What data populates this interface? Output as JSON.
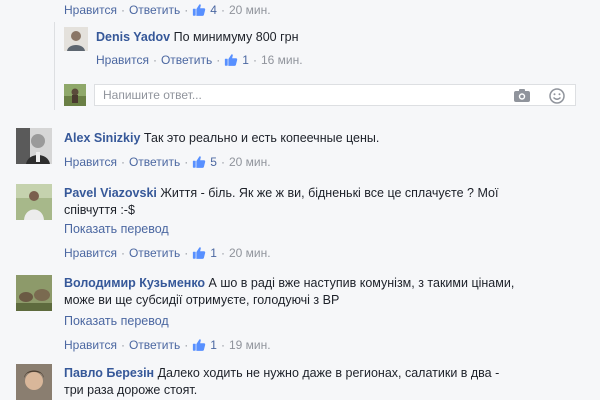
{
  "top_actions": {
    "like": "Нравится",
    "reply": "Ответить",
    "likes": "4",
    "time": "20 мин."
  },
  "reply": {
    "author": "Denis Yadov",
    "text": "По минимуму 800 грн",
    "like": "Нравится",
    "answer": "Ответить",
    "likes": "1",
    "time": "16 мин."
  },
  "reply_box": {
    "placeholder": "Напишите ответ..."
  },
  "comments": [
    {
      "author": "Alex Sinizkiy",
      "text": "Так это реально и есть копеечные цены.",
      "like": "Нравится",
      "answer": "Ответить",
      "likes": "5",
      "time": "20 мин."
    },
    {
      "author": "Pavel Viazovski",
      "text": "Життя - біль. Як же ж ви, бідненькі все це сплачуєте ? Мої",
      "text2": "співчуття :-$",
      "translate": "Показать перевод",
      "like": "Нравится",
      "answer": "Ответить",
      "likes": "1",
      "time": "20 мин."
    },
    {
      "author": "Володимир Кузьменко",
      "text": "А шо в раді вже наступив комунізм, з такими цінами,",
      "text2": "може ви ще субсидії отримуєте, голодуючі з ВР",
      "translate": "Показать перевод",
      "like": "Нравится",
      "answer": "Ответить",
      "likes": "1",
      "time": "19 мин."
    },
    {
      "author": "Павло Березін",
      "text": "Далеко ходить не нужно даже в регионах, салатики в два -",
      "text2": "три раза дороже стоят."
    }
  ],
  "sep": "·",
  "colors": {
    "link": "#4b67a1",
    "name": "#365899",
    "meta": "#90949c",
    "bg": "#f6f7f9"
  }
}
